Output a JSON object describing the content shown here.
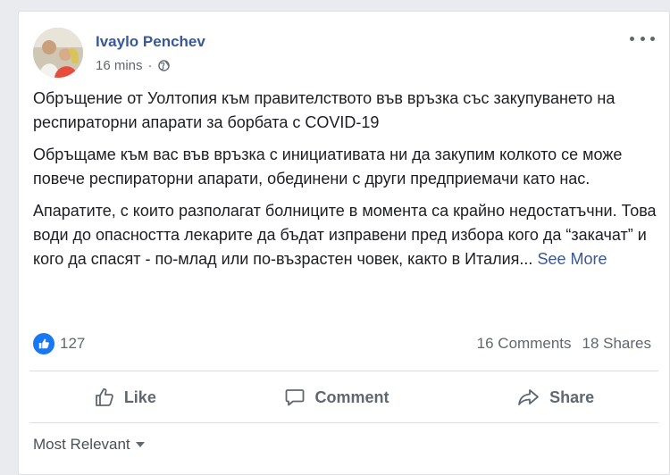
{
  "post": {
    "author": "Ivaylo Penchev",
    "time": "16 mins",
    "separator": "·",
    "privacy_icon": "globe-icon",
    "paragraphs": [
      "Обръщение от Уолтопия към правителството във връзка със закупуването на респираторни апарати за борбата с COVID-19",
      "Обръщаме към вас във връзка с инициативата ни да закупим колкото се може повече респираторни апарати, обединени с други предприемачи като нас.",
      "Апаратите, с които разполагат болниците в момента са крайно недостатъчни. Това води до опасността лекарите да бъдат изправени пред избора кого да “закачат” и кого да спасят - по-млад или по-възрастен човек, както в Италия..."
    ],
    "see_more": "See More"
  },
  "stats": {
    "reaction_count": "127",
    "comments": "16 Comments",
    "shares": "18 Shares"
  },
  "actions": {
    "like": "Like",
    "comment": "Comment",
    "share": "Share"
  },
  "comments_sort": "Most Relevant",
  "colors": {
    "accent": "#385898",
    "like_blue": "#1877f2",
    "secondary_text": "#616770"
  }
}
